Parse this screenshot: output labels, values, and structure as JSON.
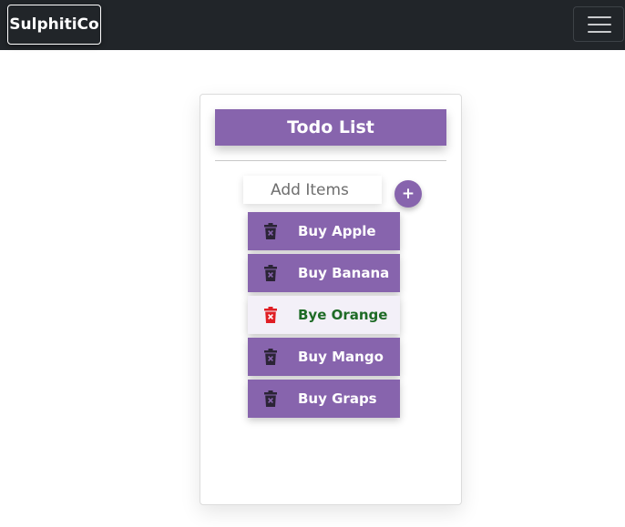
{
  "navbar": {
    "brand": "SulphitiCo"
  },
  "todo": {
    "title": "Todo List",
    "input_placeholder": "Add Items",
    "add_label": "+",
    "items": [
      {
        "label": "Buy Apple",
        "completed": false
      },
      {
        "label": "Buy Banana",
        "completed": false
      },
      {
        "label": "Bye Orange",
        "completed": true
      },
      {
        "label": "Buy Mango",
        "completed": false
      },
      {
        "label": "Buy Graps",
        "completed": false
      }
    ]
  },
  "colors": {
    "navbar_bg": "#212529",
    "accent": "#8764ad",
    "trash_icon": "#2b2436",
    "trash_icon_active": "#e01e24",
    "done_text": "#1e6b26"
  },
  "icons": {
    "item_delete": "trash-icon",
    "menu": "hamburger-icon"
  }
}
